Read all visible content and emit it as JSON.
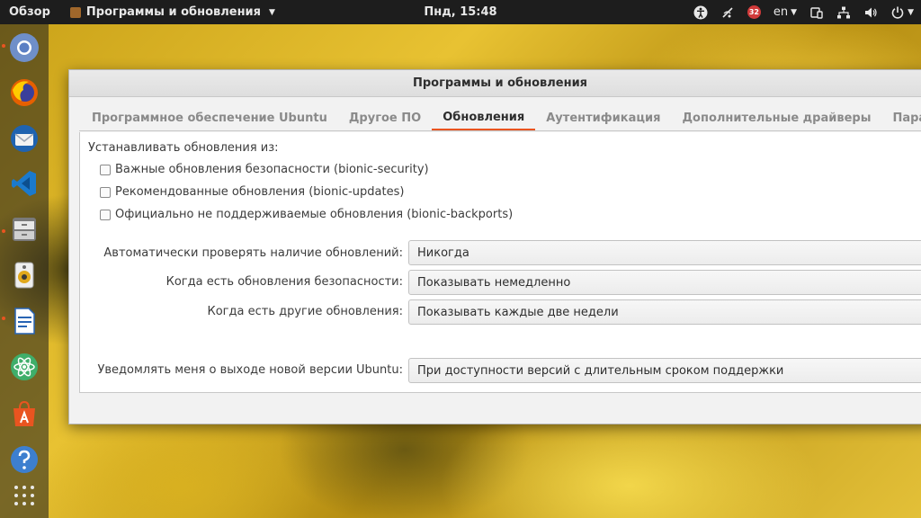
{
  "topbar": {
    "activities": "Обзор",
    "app_menu": "Программы и обновления",
    "clock": "Пнд, 15:48",
    "badge_count": "32",
    "language": "en"
  },
  "window": {
    "title": "Программы и обновления",
    "tabs": [
      {
        "label": "Программное обеспечение Ubuntu"
      },
      {
        "label": "Другое ПО"
      },
      {
        "label": "Обновления"
      },
      {
        "label": "Аутентификация"
      },
      {
        "label": "Дополнительные драйверы"
      },
      {
        "label": "Парам"
      }
    ],
    "active_tab": "Обновления",
    "updates": {
      "heading": "Устанавливать обновления из:",
      "checkboxes": [
        {
          "label": "Важные обновления безопасности (bionic-security)",
          "checked": false
        },
        {
          "label": "Рекомендованные обновления (bionic-updates)",
          "checked": false
        },
        {
          "label": "Официально не поддерживаемые обновления (bionic-backports)",
          "checked": false
        }
      ],
      "settings": [
        {
          "label": "Автоматически проверять наличие обновлений:",
          "value": "Никогда"
        },
        {
          "label": "Когда есть обновления безопасности:",
          "value": "Показывать немедленно"
        },
        {
          "label": "Когда есть другие обновления:",
          "value": "Показывать каждые две недели"
        },
        {
          "label": "Уведомлять меня о выходе новой версии Ubuntu:",
          "value": "При доступности версий с длительным сроком поддержки"
        }
      ]
    }
  },
  "colors": {
    "accent": "#e95420",
    "topbar": "#1d1d1d"
  }
}
